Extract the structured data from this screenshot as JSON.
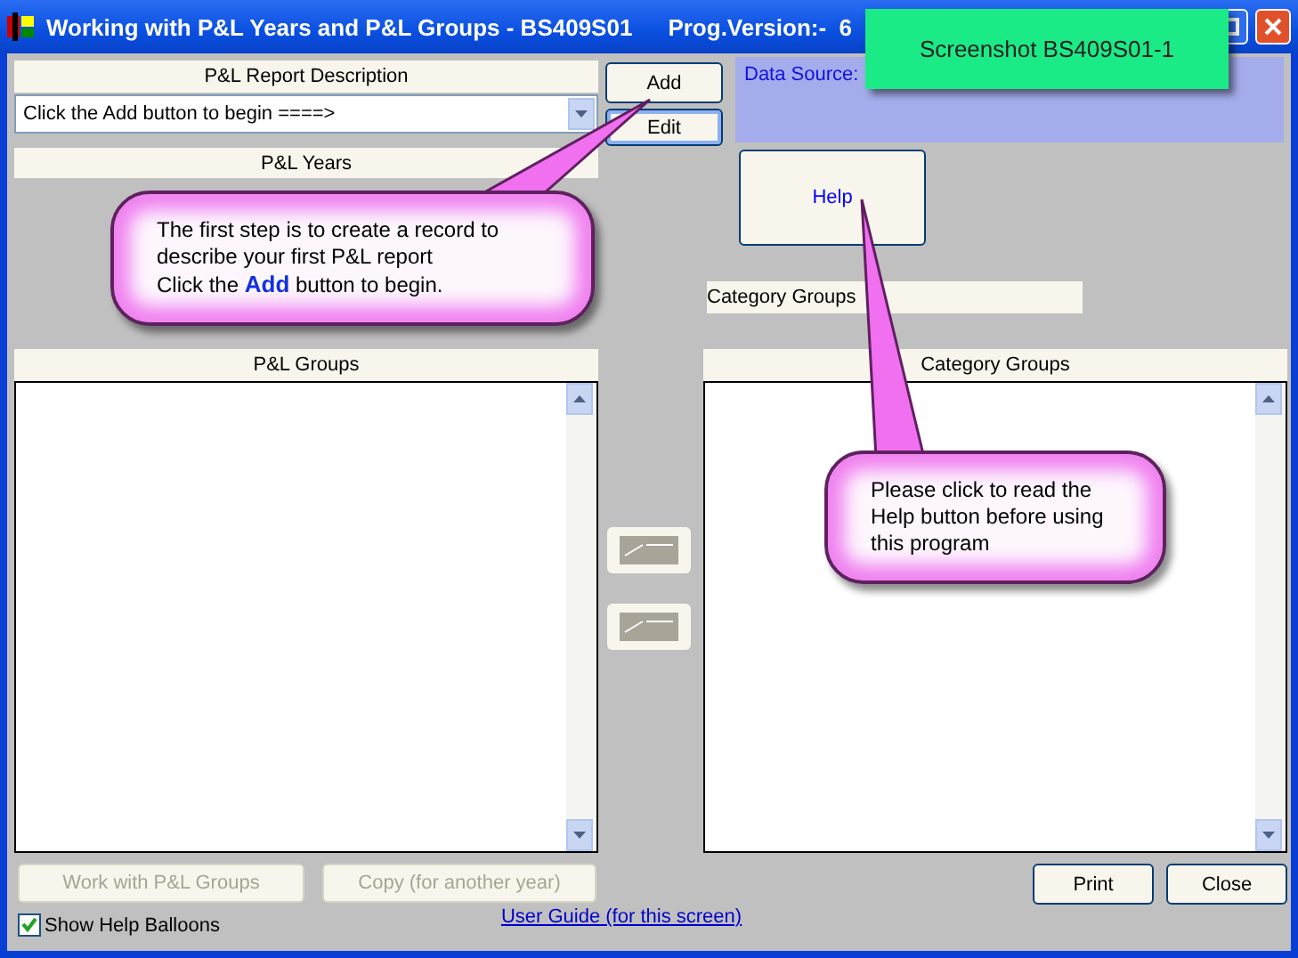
{
  "window": {
    "title": "Working with P&L Years and P&L Groups - BS409S01",
    "version": "Prog.Version:-  6"
  },
  "overlay_label": "Screenshot BS409S01-1",
  "description": {
    "header": "P&L Report Description",
    "value": "Click the Add button to begin ====>"
  },
  "years": {
    "header": "P&L Years"
  },
  "groups": {
    "header": "P&L Groups"
  },
  "add_button": "Add",
  "edit_button": "Edit",
  "data_source": "Data Source:",
  "help_button": "Help",
  "category_groups_label": "Category Groups",
  "category_groups": {
    "header": "Category Groups"
  },
  "bottom_left_buttons": [
    {
      "label": "Work with P&L Groups",
      "disabled": true
    },
    {
      "label": "Copy (for another year)",
      "disabled": true
    }
  ],
  "show_help_balloons": {
    "label": "Show Help Balloons",
    "checked": true
  },
  "user_guide_link": "User Guide (for this screen)",
  "dialog_buttons": [
    "Print",
    "Close"
  ],
  "balloons": [
    {
      "text": "The first step is to create a record to\ndescribe your first P&L report\nClick the **Add** button to begin."
    },
    {
      "text": "Please click to read the\nHelp button before using\nthis program"
    }
  ]
}
